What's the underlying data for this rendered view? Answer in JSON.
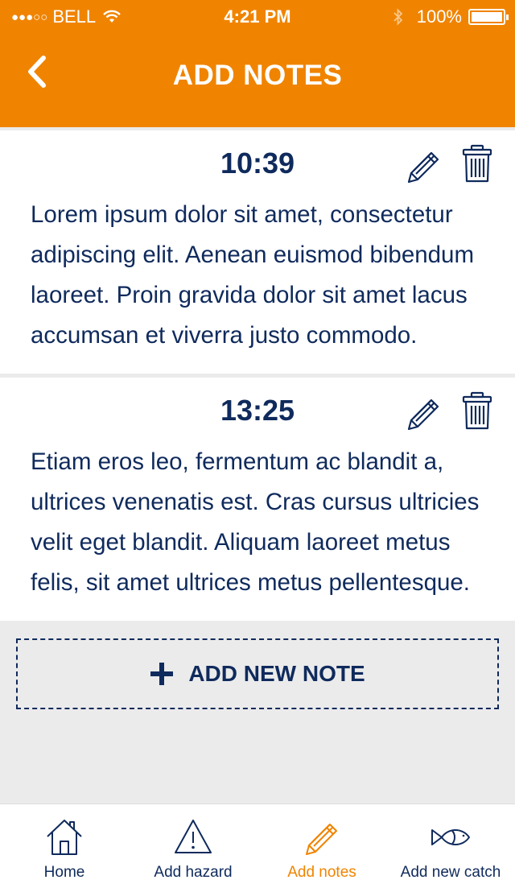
{
  "status_bar": {
    "signal": "●●●○○",
    "carrier": "BELL",
    "time": "4:21 PM",
    "battery": "100%"
  },
  "header": {
    "title": "ADD NOTES",
    "back_icon": "chevron-left-icon"
  },
  "notes": [
    {
      "time": "10:39",
      "text": "Lorem ipsum dolor sit amet, consectetur adipiscing elit. Aenean euismod bibendum laoreet. Proin gravida dolor sit amet lacus accumsan et viverra justo commodo."
    },
    {
      "time": "13:25",
      "text": "Etiam eros leo, fermentum ac blandit a, ultrices venenatis est. Cras cursus ultricies velit eget blandit. Aliquam laoreet metus felis, sit amet ultrices metus pellentesque."
    }
  ],
  "add_note": {
    "label": "ADD NEW NOTE",
    "icon": "plus-icon"
  },
  "tabbar": {
    "items": [
      {
        "label": "Home",
        "icon": "home-icon",
        "active": false
      },
      {
        "label": "Add hazard",
        "icon": "warning-icon",
        "active": false
      },
      {
        "label": "Add notes",
        "icon": "pencil-icon",
        "active": true
      },
      {
        "label": "Add new catch",
        "icon": "fish-icon",
        "active": false
      }
    ]
  },
  "colors": {
    "accent": "#f08400",
    "text": "#0f2a5c",
    "background": "#ebebeb"
  }
}
